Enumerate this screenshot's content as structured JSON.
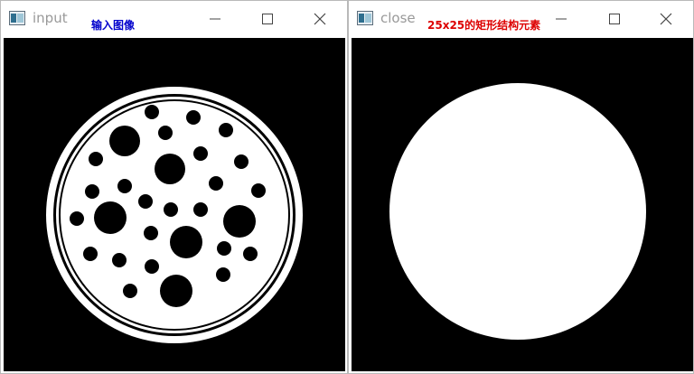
{
  "windows": {
    "input": {
      "title": "input",
      "annotation": "输入图像",
      "annotation_color": "#0000cc",
      "icon": "app-window-icon"
    },
    "close": {
      "title": "close",
      "annotation": "25x25的矩形结构元素",
      "annotation_color": "#dd0000",
      "icon": "app-window-icon"
    }
  },
  "controls": [
    "minimize-icon",
    "maximize-icon",
    "close-icon"
  ],
  "colors": {
    "image_background": "#000000",
    "image_foreground": "#ffffff",
    "title_text": "#999999"
  }
}
